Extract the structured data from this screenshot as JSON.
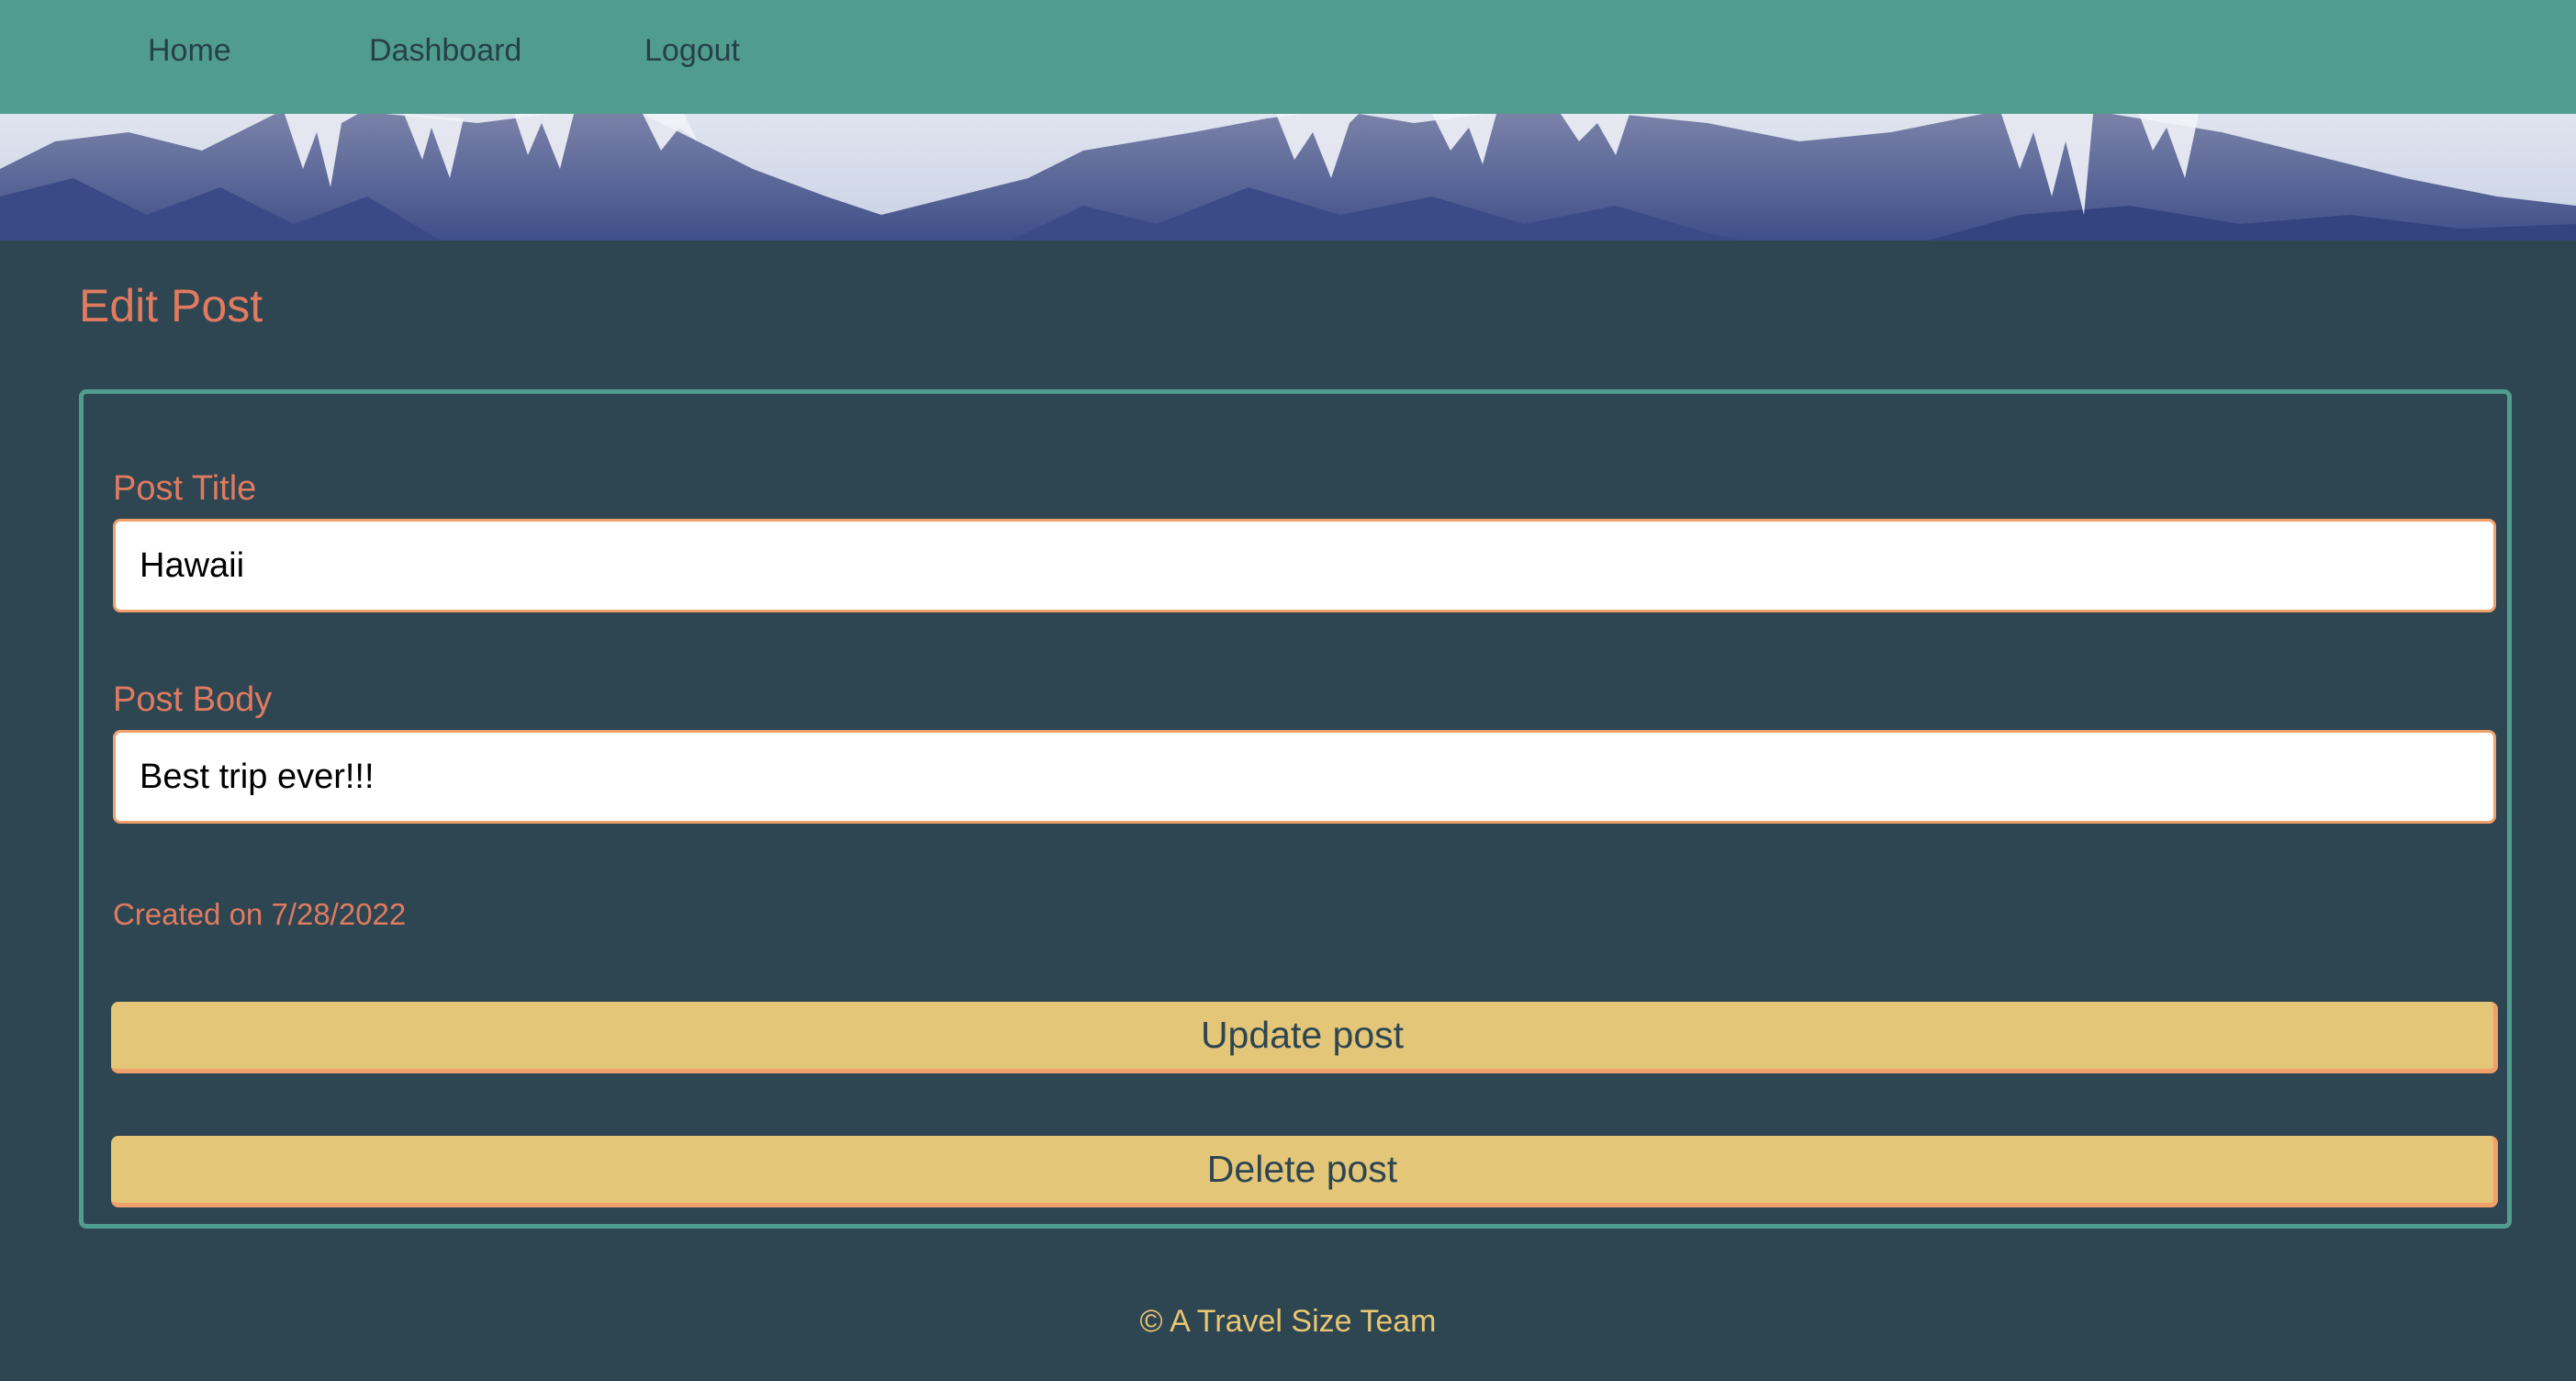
{
  "nav": {
    "items": [
      {
        "label": "Home"
      },
      {
        "label": "Dashboard"
      },
      {
        "label": "Logout"
      }
    ]
  },
  "banner": {
    "image": "snow-capped-mountain-range"
  },
  "page": {
    "title": "Edit Post"
  },
  "form": {
    "title_label": "Post Title",
    "title_value": "Hawaii",
    "body_label": "Post Body",
    "body_value": "Best trip ever!!!",
    "created_on": "Created on 7/28/2022",
    "update_label": "Update post",
    "delete_label": "Delete post"
  },
  "footer": {
    "text": "© A Travel Size Team"
  },
  "colors": {
    "nav_bg": "#509c8e",
    "page_bg": "#2e4552",
    "accent": "#e07b5f",
    "button_bg": "#e3c677",
    "button_border": "#f0a06a",
    "footer_text": "#e8c672"
  }
}
